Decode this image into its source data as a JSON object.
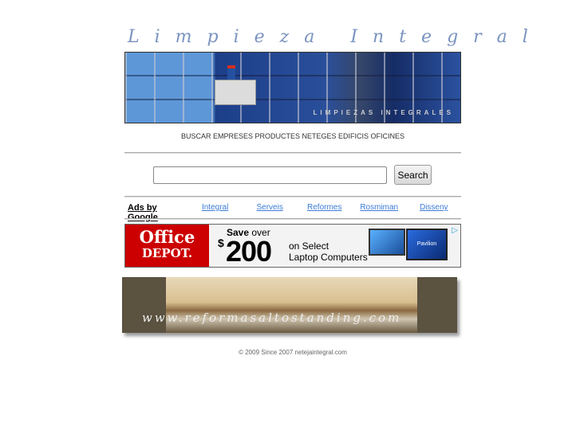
{
  "header": {
    "logo_text": "Limpieza Integral",
    "banner_text": "LIMPIEZAS INTEGRALES"
  },
  "nav": {
    "keywords": "BUSCAR EMPRESES PRODUCTES NETEGES EDIFICIS OFICINES"
  },
  "search": {
    "value": "",
    "button_label": "Search"
  },
  "ads": {
    "label": "Ads by Google",
    "links": [
      "Integral",
      "Serveis",
      "Reformes",
      "Rosmiman",
      "Disseny"
    ]
  },
  "ad_banner": {
    "brand_line1": "Office",
    "brand_line2": "DEPOT.",
    "save": "Save",
    "over": "over",
    "dollar": "$",
    "amount": "200",
    "line1": "on Select",
    "line2": "Laptop Computers",
    "laptop_label": "Pavilion",
    "adchoice_icon": "adchoices-icon"
  },
  "hotel_banner": {
    "url": "www.reformasaltostanding.com"
  },
  "footer": {
    "text": "© 2009 Since 2007 netejaintegral.com"
  }
}
